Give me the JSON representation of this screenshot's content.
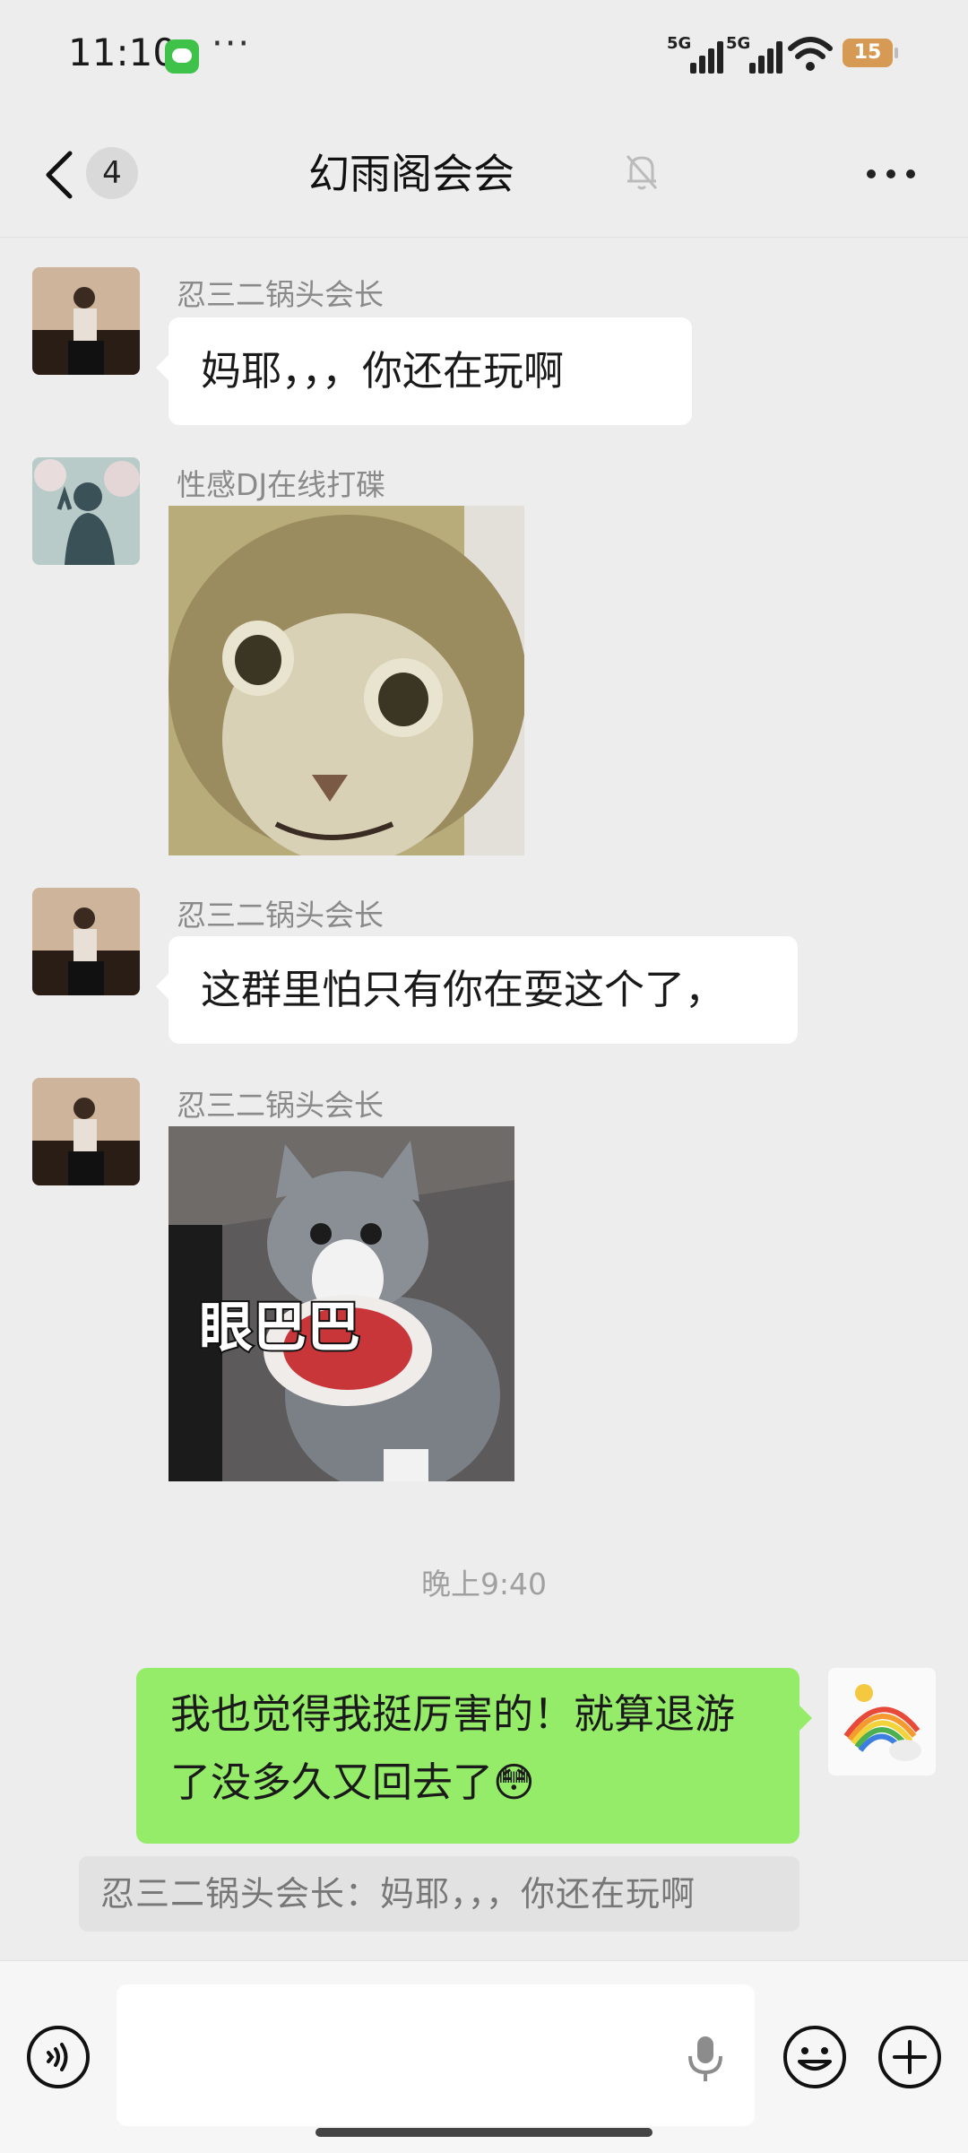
{
  "status_bar": {
    "time": "11:10",
    "signal1_label": "5G",
    "signal2_label": "5G",
    "battery_level": "15"
  },
  "header": {
    "unread_count": "4",
    "title": "幻雨阁会会",
    "muted": true
  },
  "messages": [
    {
      "side": "left",
      "sender": "忍三二锅头会长",
      "type": "text",
      "text": "妈耶，，，你还在玩啊"
    },
    {
      "side": "left",
      "sender": "性感DJ在线打碟",
      "type": "sticker",
      "sticker": "cat-staring"
    },
    {
      "side": "left",
      "sender": "忍三二锅头会长",
      "type": "text",
      "text": "这群里怕只有你在耍这个了，"
    },
    {
      "side": "left",
      "sender": "忍三二锅头会长",
      "type": "sticker",
      "sticker": "cat-bib",
      "sticker_text": "眼巴巴"
    }
  ],
  "timestamp": "晚上9:40",
  "my_message": {
    "text": "我也觉得我挺厉害的！就算退游了没多久又回去了😳"
  },
  "quote": {
    "text": "忍三二锅头会长：妈耶，，，你还在玩啊"
  },
  "input": {
    "placeholder": "",
    "value": ""
  },
  "colors": {
    "bubble_mine": "#95ec69",
    "bubble_other": "#ffffff",
    "background": "#ededed",
    "battery": "#d69a55"
  }
}
